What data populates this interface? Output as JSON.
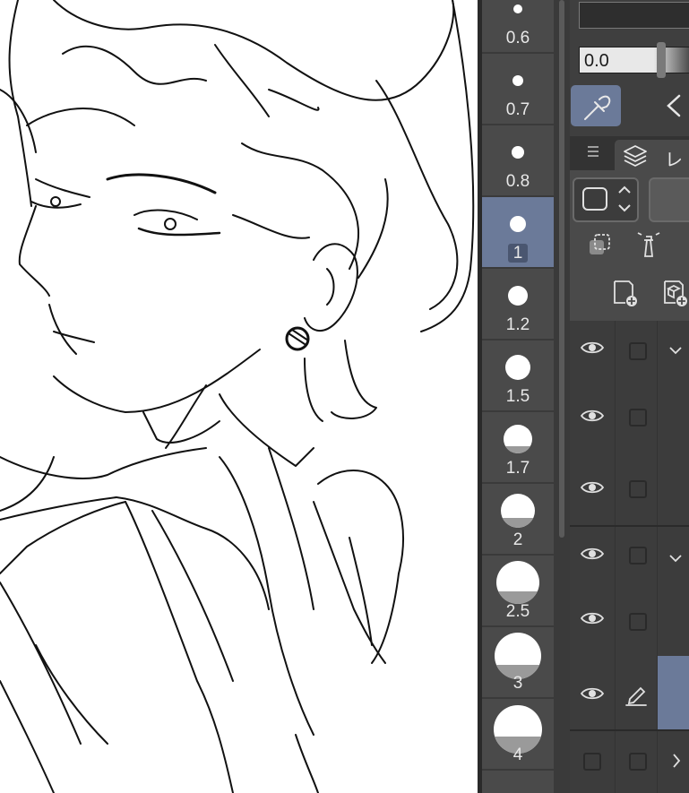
{
  "brush_sizes": [
    {
      "label": "0.6"
    },
    {
      "label": "0.7"
    },
    {
      "label": "0.8"
    },
    {
      "label": "1",
      "selected": true
    },
    {
      "label": "1.2"
    },
    {
      "label": "1.5"
    },
    {
      "label": "1.7"
    },
    {
      "label": "2"
    },
    {
      "label": "2.5"
    },
    {
      "label": "3"
    },
    {
      "label": "4"
    }
  ],
  "slider": {
    "value": "0.0"
  },
  "layer_panel": {
    "tab_label": "レイ"
  },
  "icons": {
    "eyedropper": "eyedropper-icon",
    "back": "chevron-left-icon",
    "menu": "menu-icon",
    "layers": "layers-icon",
    "eye": "eye-icon",
    "pen": "pen-icon"
  },
  "colors": {
    "accent": "#6b7a99",
    "panel": "#4a4a4a"
  }
}
